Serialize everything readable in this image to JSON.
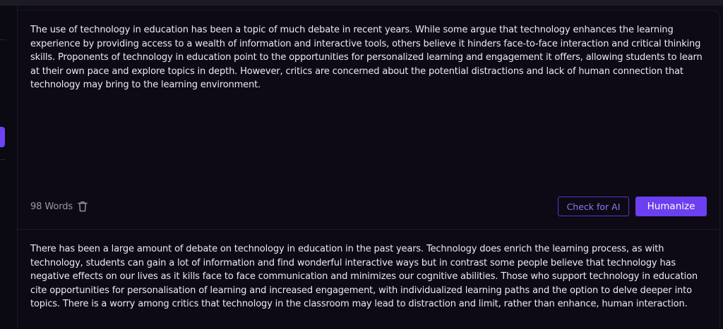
{
  "input": {
    "text": "The use of technology in education has been a topic of much debate in recent years. While some argue that technology enhances the learning experience by providing access to a wealth of information and interactive tools, others believe it hinders face-to-face interaction and critical thinking skills. Proponents of technology in education point to the opportunities for personalized learning and engagement it offers, allowing students to learn at their own pace and explore topics in depth. However, critics are concerned about the potential distractions and lack of human connection that technology may bring to the learning environment.",
    "word_count": "98 Words"
  },
  "actions": {
    "check_label": "Check for AI",
    "humanize_label": "Humanize"
  },
  "output": {
    "text": "There has been a large amount of debate on technology in education in the past years. Technology does enrich the learning process, as with technology, students can gain a lot of information and find wonderful interactive ways but in contrast some people believe that technology has negative effects on our lives as it kills face to face communication and minimizes our cognitive abilities. Those who support technology in education cite opportunities for personalisation of learning and increased engagement, with individualized learning paths and the option to delve deeper into topics. There is a worry among critics that technology in the classroom may lead to distraction and limit, rather than enhance, human interaction."
  },
  "icons": {
    "delete": "trash-icon"
  },
  "colors": {
    "accent": "#6c3ff0",
    "background": "#0d0a15",
    "text": "#eeeaf4",
    "muted": "#9b97a6"
  }
}
